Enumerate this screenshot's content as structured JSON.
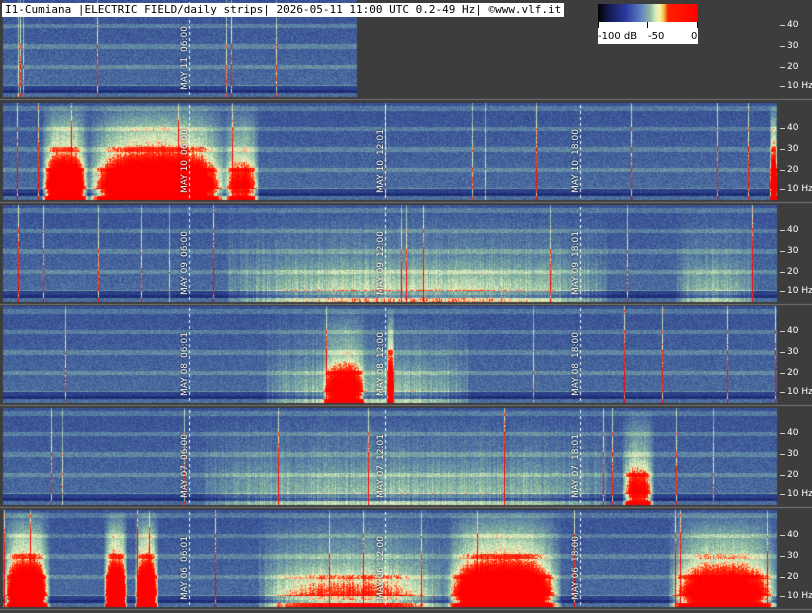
{
  "header": {
    "title": "I1-Cumiana |ELECTRIC FIELD/daily strips| 2026-05-11 11:00 UTC 0.2-49 Hz| ©www.vlf.it"
  },
  "scale": {
    "labels": [
      "-100 dB",
      "-50",
      "0"
    ]
  },
  "freq_labels": [
    "40",
    "30",
    "20",
    "10 Hz"
  ],
  "strips": [
    {
      "date": "MAY 11",
      "markers": [
        "06:00"
      ],
      "end_fraction": 0.458
    },
    {
      "date": "MAY 10",
      "markers": [
        "06:00",
        "12:01",
        "18:00"
      ]
    },
    {
      "date": "MAY 09",
      "markers": [
        "06:00",
        "12:00",
        "18:01"
      ]
    },
    {
      "date": "MAY 08",
      "markers": [
        "06:01",
        "12:00",
        "18:00"
      ]
    },
    {
      "date": "MAY 07",
      "markers": [
        "06:00",
        "12:01",
        "18:01"
      ]
    },
    {
      "date": "MAY 06",
      "markers": [
        "06:01",
        "12:00",
        "18:00"
      ]
    }
  ],
  "colors": {
    "background": "#3d3d3d",
    "spectrogram_low": "#2a3a8c",
    "spectrogram_mid": "#7fa8a0",
    "spectrogram_high": "#ff0000"
  }
}
